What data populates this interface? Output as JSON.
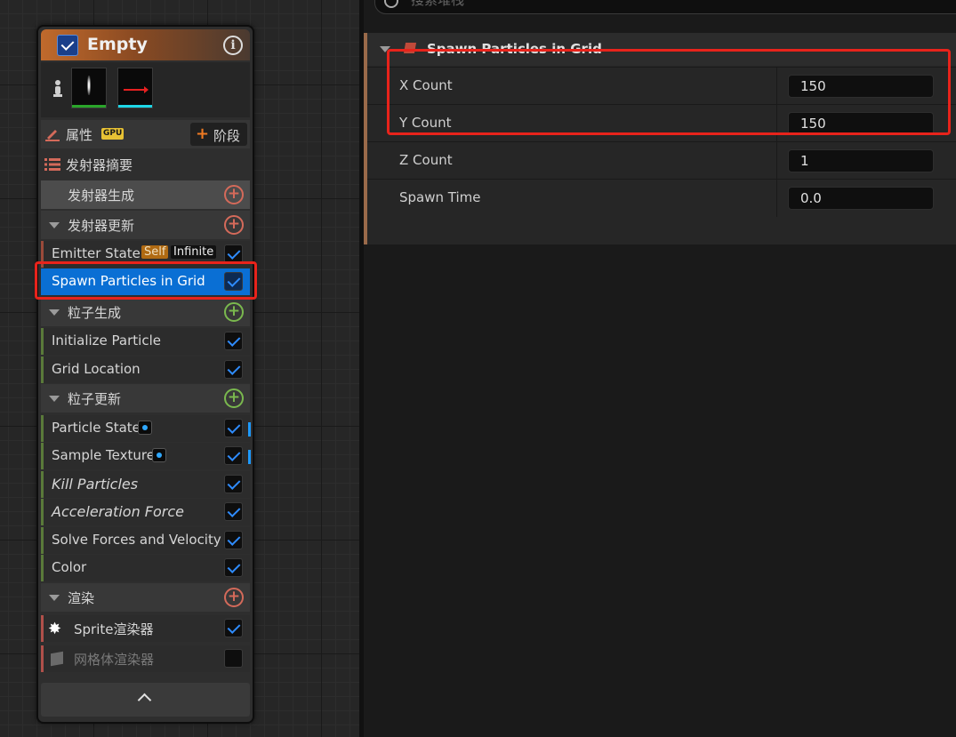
{
  "node": {
    "title": "Empty",
    "properties_label": "属性",
    "gpu_badge": "GPU",
    "stage_button_label": "阶段",
    "summary_label": "发射器摘要",
    "emitter_spawn_label": "发射器生成",
    "emitter_update_label": "发射器更新",
    "emitter_state_label": "Emitter State",
    "self_badge": "Self",
    "infinite_badge": "Infinite",
    "spawn_grid_label": "Spawn Particles in Grid",
    "particle_spawn_label": "粒子生成",
    "initialize_particle_label": "Initialize Particle",
    "grid_location_label": "Grid Location",
    "particle_update_label": "粒子更新",
    "particle_state_label": "Particle State",
    "sample_texture_label": "Sample Texture",
    "kill_particles_label": "Kill Particles",
    "acceleration_force_label": "Acceleration Force",
    "solve_forces_label": "Solve Forces and Velocity",
    "color_label": "Color",
    "render_label": "渲染",
    "sprite_renderer_label": "Sprite渲染器",
    "mesh_renderer_label": "网格体渲染器"
  },
  "details": {
    "search_placeholder": "搜索堆栈",
    "group_title": "Spawn Particles in Grid",
    "rows": [
      {
        "label": "X Count",
        "value": "150"
      },
      {
        "label": "Y Count",
        "value": "150"
      },
      {
        "label": "Z Count",
        "value": "1"
      },
      {
        "label": "Spawn Time",
        "value": "0.0"
      }
    ]
  },
  "colors": {
    "selected_row": "#0a6fd4",
    "highlight_box": "#e8231b",
    "node_header": "#c06a2c",
    "checkmark": "#2f8cff"
  },
  "icons": [
    "info-icon",
    "person-icon",
    "pencil-icon",
    "list-icon",
    "plus-circle-icon",
    "sprite-icon",
    "mesh-icon",
    "search-icon",
    "chevron-up-icon"
  ]
}
